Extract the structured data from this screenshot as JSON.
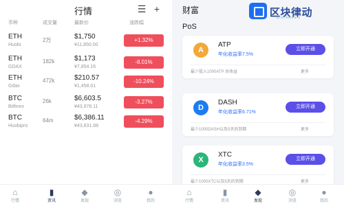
{
  "market": {
    "title": "行情",
    "tabs": [
      "币种",
      "成交量",
      "最新价",
      "涨跌幅"
    ],
    "rows": [
      {
        "sym": "ETH",
        "exch": "Huobi",
        "vol": "2万",
        "price": "$1,750",
        "cny": "¥11,850.00",
        "chg": "+1.32%"
      },
      {
        "sym": "ETH",
        "exch": "GDAX",
        "vol": "182k",
        "price": "$1,173",
        "cny": "¥7,854.16",
        "chg": "-8.01%"
      },
      {
        "sym": "ETH",
        "exch": "Gdax",
        "vol": "472k",
        "price": "$210.57",
        "cny": "¥1,458.01",
        "chg": "-10.24%"
      },
      {
        "sym": "BTC",
        "exch": "Bitfinex",
        "vol": "26k",
        "price": "$6,603.5",
        "cny": "¥43,978.11",
        "chg": "-3.27%"
      },
      {
        "sym": "BTC",
        "exch": "Huobipro",
        "vol": "64m",
        "price": "$6,386.11",
        "cny": "¥43,831.68",
        "chg": "-4.29%"
      }
    ],
    "nav": [
      "行情",
      "资讯",
      "发现",
      "浏览",
      "我的"
    ],
    "nav_active": 1
  },
  "wallet": {
    "title": "财富",
    "logo_name": "区块律动",
    "logo_sub": "BlockBeats",
    "section": "PoS",
    "cards": [
      {
        "name": "ATP",
        "rate": "年化收益率7.5%",
        "min": "最少投入1000ATP 总收益",
        "btn": "立即开通",
        "more": "更多",
        "coin_color": "#f2a93b",
        "coin_glyph": "A"
      },
      {
        "name": "DASH",
        "rate": "年化收益率6.71%",
        "min": "最少1000DASH以及5天后到期",
        "btn": "立即开通",
        "more": "更多",
        "coin_color": "#1c7cf2",
        "coin_glyph": "D"
      },
      {
        "name": "XTC",
        "rate": "年化收益率3.5%",
        "min": "最少1000XTC以及5天后到期",
        "btn": "立即开通",
        "more": "更多",
        "coin_color": "#2bb57a",
        "coin_glyph": "X"
      }
    ],
    "nav": [
      "行情",
      "资讯",
      "发现",
      "浏览",
      "我的"
    ],
    "nav_active": 2
  }
}
